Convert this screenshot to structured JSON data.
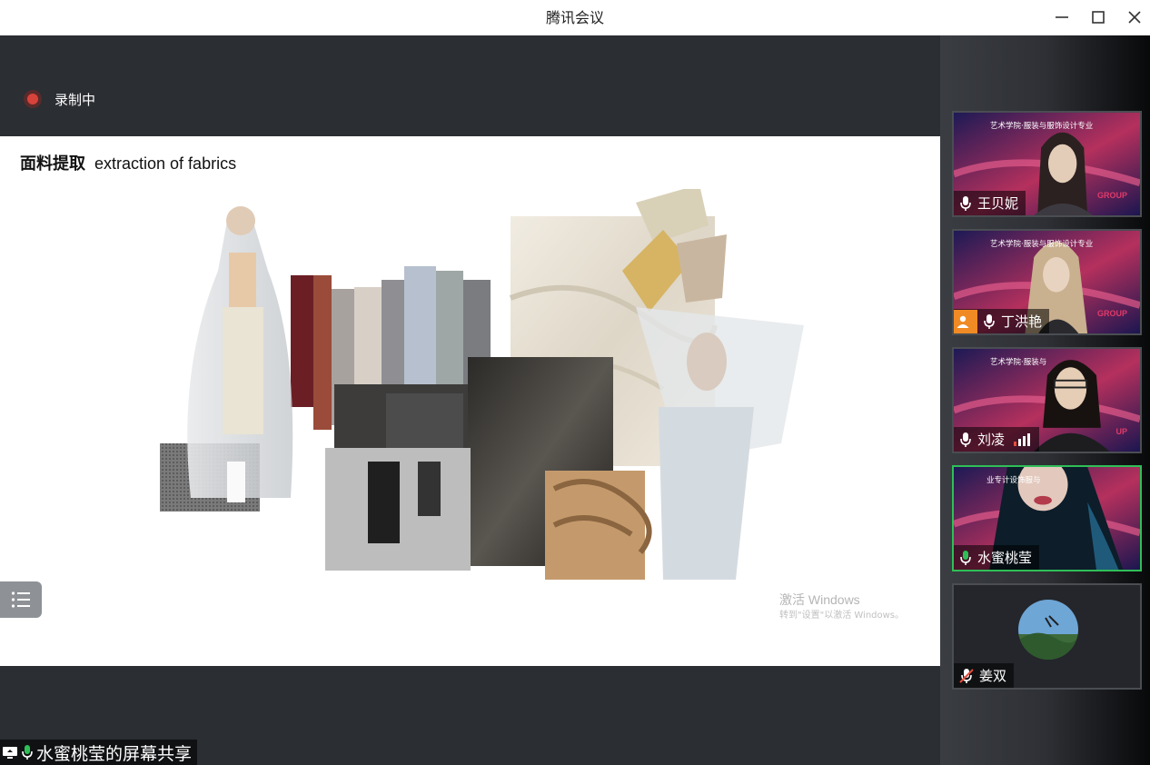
{
  "window": {
    "title": "腾讯会议"
  },
  "recording": {
    "label": "录制中"
  },
  "slide": {
    "title_cn": "面料提取",
    "title_en": "extraction of fabrics",
    "watermark_line1": "激活 Windows",
    "watermark_line2": "转到\"设置\"以激活 Windows。"
  },
  "share_label": "水蜜桃莹的屏幕共享",
  "participants": [
    {
      "name": "王贝妮",
      "mic": "mic-icon",
      "banner": "艺术学院·服装与服饰设计专业",
      "group": "GROUP"
    },
    {
      "name": "丁洪艳",
      "mic": "mic-icon",
      "banner": "艺术学院·服装与服饰设计专业",
      "group": "GROUP"
    },
    {
      "name": "刘凌",
      "mic": "mic-icon",
      "banner": "艺术学院·服装与",
      "group": "UP"
    },
    {
      "name": "水蜜桃莹",
      "mic": "mic-active-icon",
      "banner": "业专计设饰服与",
      "active_color": "#2fbf57"
    },
    {
      "name": "姜双",
      "mic": "mic-muted-icon"
    }
  ],
  "colors": {
    "accent_green": "#2fbf57",
    "record_red": "#d7433a",
    "avatar_orange": "#f08a24"
  }
}
